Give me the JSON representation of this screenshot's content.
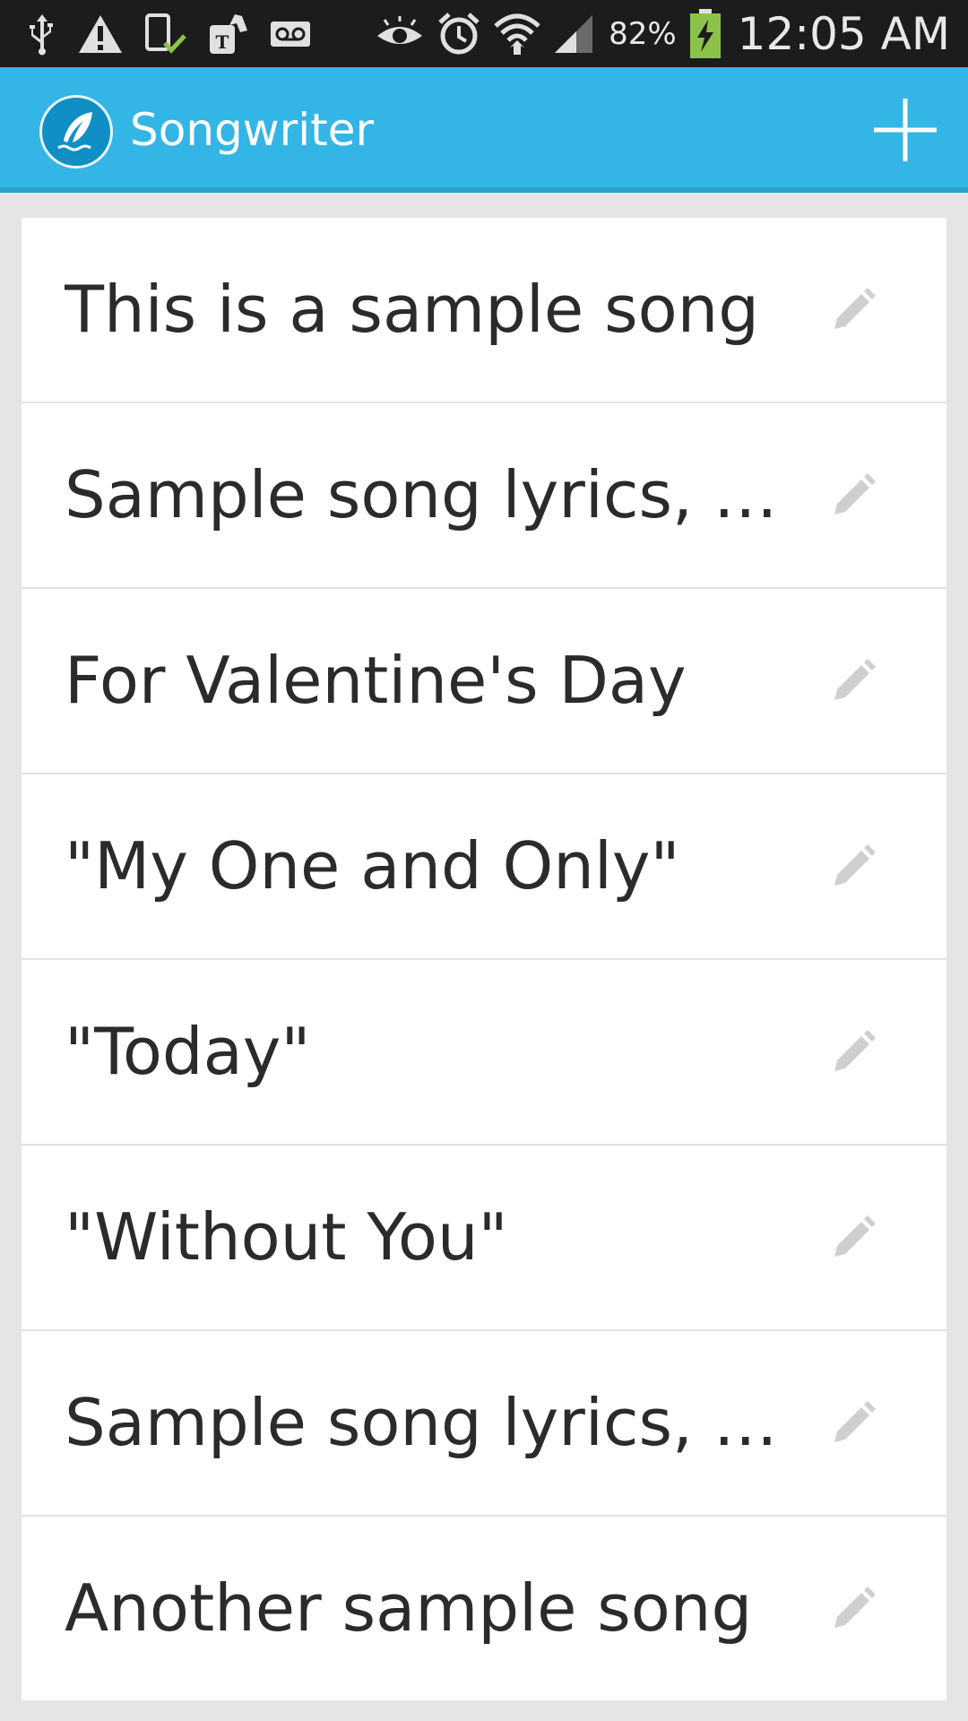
{
  "status_bar": {
    "icons_left": [
      "usb-icon",
      "warning-icon",
      "device-check-icon",
      "tmobile-icon",
      "voicemail-icon"
    ],
    "icons_right": [
      "eye-icon",
      "alarm-icon",
      "wifi-icon",
      "signal-icon",
      "battery-charging-icon"
    ],
    "battery_percent": "82%",
    "time": "12:05 AM"
  },
  "action_bar": {
    "app_icon": "quill-logo-icon",
    "title": "Songwriter",
    "add_icon": "plus-icon",
    "accent_color": "#33b5e5"
  },
  "songs": [
    {
      "title": "This is a sample song"
    },
    {
      "title": "Sample song lyrics, n..."
    },
    {
      "title": "For Valentine's Day"
    },
    {
      "title": "\"My One and Only\""
    },
    {
      "title": "\"Today\""
    },
    {
      "title": "\"Without You\""
    },
    {
      "title": "Sample song lyrics, n..."
    },
    {
      "title": "Another sample song"
    }
  ],
  "row_action_icon": "pencil-edit-icon"
}
